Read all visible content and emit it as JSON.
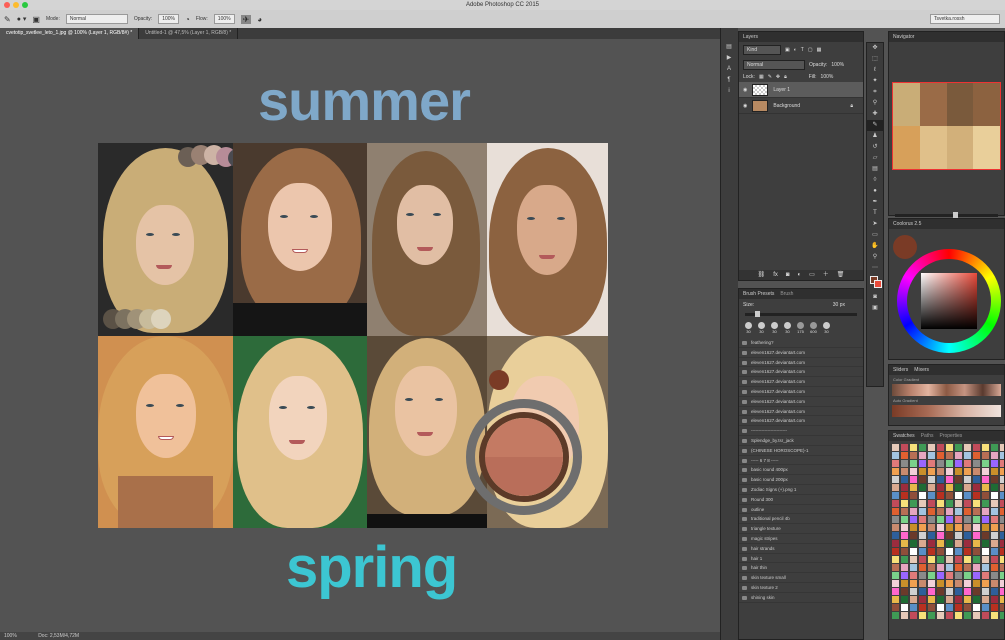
{
  "app": {
    "title": "Adobe Photoshop CC 2015",
    "workspace": "Tsvetka.rossh"
  },
  "options": {
    "mode_label": "Mode:",
    "mode": "Normal",
    "opacity_label": "Opacity:",
    "opacity": "100%",
    "flow_label": "Flow:",
    "flow": "100%"
  },
  "tabs": [
    {
      "label": "cvetotip_svetlee_leto_1.jpg @ 100% (Layer 1, RGB/8#) *"
    },
    {
      "label": "Untitled-1 @ 47,5% (Layer 1, RGB/8) *"
    }
  ],
  "canvas": {
    "word_top": "summer",
    "word_bottom": "spring",
    "word_top_color": "#7fa8c9",
    "word_bottom_color": "#3cc6d2"
  },
  "statusbar": {
    "zoom": "100%",
    "doc": "Doc: 2,53M/4,72M"
  },
  "layers": {
    "panel_title": "Layers",
    "kind_label": "Kind",
    "blend": "Normal",
    "opacity_label": "Opacity:",
    "opacity": "100%",
    "lock_label": "Lock:",
    "fill_label": "Fill:",
    "fill": "100%",
    "items": [
      {
        "name": "Layer 1"
      },
      {
        "name": "Background"
      }
    ]
  },
  "brushes": {
    "tabs": [
      "Brush Presets",
      "Brush"
    ],
    "size_label": "Size:",
    "size": "30 px",
    "tip_sizes": [
      "30",
      "30",
      "30",
      "30",
      "175",
      "600",
      "30"
    ],
    "items": [
      "feathering?",
      "eleven1627.deviantart.com",
      "eleven1627.deviantart.com",
      "eleven1627.deviantart.com",
      "eleven1627.deviantart.com",
      "eleven1627.deviantart.com",
      "eleven1627.deviantart.com",
      "eleven1627.deviantart.com",
      "eleven1627.deviantart.com",
      "------------------------",
      "Splendge_by.tsr_jack",
      "(CHINESE HOROSCOPE)-1",
      "----- 6 7 8 -----",
      "basic round 400px",
      "basic round 200px",
      "Zodiac Signs (+).png 1",
      "Round 300",
      "outline",
      "traditional pencil 4b",
      "triangle texture",
      "magic stripes",
      "hair strands",
      "hair 1",
      "hair thin",
      "skin texture small",
      "skin texture 2",
      "shining skin"
    ]
  },
  "navigator": {
    "title": "Navigator"
  },
  "coolorus": {
    "title": "Coolorus 2.5",
    "foreground": "#7a3b26"
  },
  "mixers": {
    "tabs": [
      "Sliders",
      "Mixers"
    ],
    "left_label": "Color Gradient",
    "right_label": "Auto Gradient"
  },
  "swatches": {
    "tabs": [
      "Swatches",
      "Paths",
      "Properties"
    ]
  }
}
